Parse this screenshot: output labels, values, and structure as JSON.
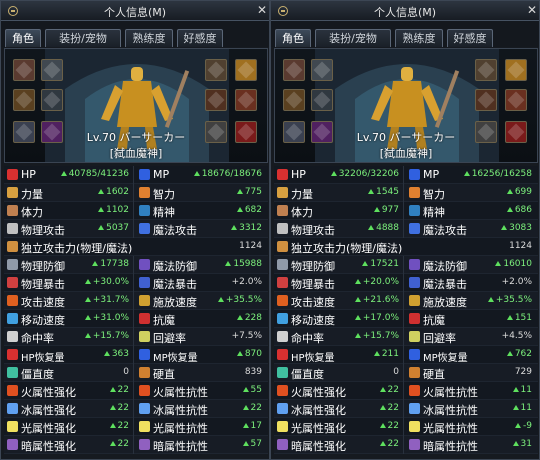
{
  "panels": [
    {
      "title": "个人信息(M)",
      "tabs": [
        "角色",
        "装扮/宠物",
        "熟练度",
        "好感度"
      ],
      "level": "Lv.70 バーサーカー",
      "char_title": "[弑血魔神]",
      "stats": [
        {
          "type": "pair",
          "l": {
            "name": "HP",
            "value": "40785/41236",
            "up": true,
            "icon": "heart-icon",
            "color": "#d83030"
          },
          "r": {
            "name": "MP",
            "value": "18676/18676",
            "up": true,
            "icon": "mp-heart-icon",
            "color": "#3060e0"
          }
        },
        {
          "type": "pair",
          "l": {
            "name": "力量",
            "value": "1602",
            "up": true,
            "icon": "strength-icon",
            "color": "#d8a040"
          },
          "r": {
            "name": "智力",
            "value": "775",
            "up": true,
            "icon": "intelligence-icon",
            "color": "#e08030"
          }
        },
        {
          "type": "pair",
          "l": {
            "name": "体力",
            "value": "1102",
            "up": true,
            "icon": "vitality-icon",
            "color": "#c08050"
          },
          "r": {
            "name": "精神",
            "value": "682",
            "up": true,
            "icon": "spirit-icon",
            "color": "#3080c0"
          }
        },
        {
          "type": "pair",
          "l": {
            "name": "物理攻击",
            "value": "5037",
            "up": true,
            "icon": "phys-attack-icon",
            "color": "#c0c0c0"
          },
          "r": {
            "name": "魔法攻击",
            "value": "3312",
            "up": true,
            "icon": "magic-attack-icon",
            "color": "#4070e0"
          }
        },
        {
          "type": "full",
          "l": {
            "name": "独立攻击力(物理/魔法)",
            "value": "1124",
            "up": false,
            "icon": "independent-attack-icon",
            "color": "#d09040"
          }
        },
        {
          "type": "pair",
          "l": {
            "name": "物理防御",
            "value": "17738",
            "up": true,
            "icon": "phys-defense-icon",
            "color": "#909aa8"
          },
          "r": {
            "name": "魔法防御",
            "value": "15988",
            "up": true,
            "icon": "magic-defense-icon",
            "color": "#7050c0"
          }
        },
        {
          "type": "pair",
          "l": {
            "name": "物理暴击",
            "value": "+30.0%",
            "up": true,
            "icon": "phys-crit-icon",
            "color": "#d04040"
          },
          "r": {
            "name": "魔法暴击",
            "value": "+2.0%",
            "up": false,
            "icon": "magic-crit-icon",
            "color": "#4060d0"
          }
        },
        {
          "type": "pair",
          "l": {
            "name": "攻击速度",
            "value": "+31.7%",
            "up": true,
            "icon": "attack-speed-icon",
            "color": "#e06020"
          },
          "r": {
            "name": "施放速度",
            "value": "+35.5%",
            "up": true,
            "icon": "cast-speed-icon",
            "color": "#d0a030"
          }
        },
        {
          "type": "pair",
          "l": {
            "name": "移动速度",
            "value": "+31.0%",
            "up": true,
            "icon": "move-speed-icon",
            "color": "#40a0e0"
          },
          "r": {
            "name": "抗魔",
            "value": "228",
            "up": true,
            "icon": "magic-resist-icon",
            "color": "#d03030"
          }
        },
        {
          "type": "pair",
          "l": {
            "name": "命中率",
            "value": "+15.7%",
            "up": true,
            "icon": "hit-rate-icon",
            "color": "#d0d0d0"
          },
          "r": {
            "name": "回避率",
            "value": "+7.5%",
            "up": false,
            "icon": "evasion-icon",
            "color": "#d0d060"
          }
        },
        {
          "type": "pair",
          "l": {
            "name": "HP恢复量",
            "value": "363",
            "up": true,
            "icon": "hp-regen-icon",
            "color": "#d83030",
            "small": true
          },
          "r": {
            "name": "MP恢复量",
            "value": "870",
            "up": true,
            "icon": "mp-regen-icon",
            "color": "#3060e0",
            "small": true
          }
        },
        {
          "type": "pair",
          "l": {
            "name": "僵直度",
            "value": "0",
            "up": false,
            "icon": "stiffness-icon",
            "color": "#40c0a0"
          },
          "r": {
            "name": "硬直",
            "value": "839",
            "up": false,
            "icon": "hit-recovery-icon",
            "color": "#d08030"
          }
        },
        {
          "type": "pair",
          "l": {
            "name": "火属性强化",
            "value": "22",
            "up": true,
            "icon": "fire-boost-icon",
            "color": "#e05020"
          },
          "r": {
            "name": "火属性抗性",
            "value": "55",
            "up": true,
            "icon": "fire-resist-icon",
            "color": "#e05020"
          }
        },
        {
          "type": "pair",
          "l": {
            "name": "冰属性强化",
            "value": "22",
            "up": true,
            "icon": "ice-boost-icon",
            "color": "#60a0f0"
          },
          "r": {
            "name": "冰属性抗性",
            "value": "22",
            "up": true,
            "icon": "ice-resist-icon",
            "color": "#60a0f0"
          }
        },
        {
          "type": "pair",
          "l": {
            "name": "光属性强化",
            "value": "22",
            "up": true,
            "icon": "light-boost-icon",
            "color": "#f0e060"
          },
          "r": {
            "name": "光属性抗性",
            "value": "17",
            "up": true,
            "icon": "light-resist-icon",
            "color": "#f0e060"
          }
        },
        {
          "type": "pair",
          "l": {
            "name": "暗属性强化",
            "value": "22",
            "up": true,
            "icon": "dark-boost-icon",
            "color": "#9060c0"
          },
          "r": {
            "name": "暗属性抗性",
            "value": "57",
            "up": true,
            "icon": "dark-resist-icon",
            "color": "#9060c0"
          }
        }
      ]
    },
    {
      "title": "个人信息(M)",
      "tabs": [
        "角色",
        "装扮/宠物",
        "熟练度",
        "好感度"
      ],
      "level": "Lv.70 バーサーカー",
      "char_title": "[弑血魔神]",
      "stats": [
        {
          "type": "pair",
          "l": {
            "name": "HP",
            "value": "32206/32206",
            "up": true,
            "icon": "heart-icon",
            "color": "#d83030"
          },
          "r": {
            "name": "MP",
            "value": "16256/16258",
            "up": true,
            "icon": "mp-heart-icon",
            "color": "#3060e0"
          }
        },
        {
          "type": "pair",
          "l": {
            "name": "力量",
            "value": "1545",
            "up": true,
            "icon": "strength-icon",
            "color": "#d8a040"
          },
          "r": {
            "name": "智力",
            "value": "699",
            "up": true,
            "icon": "intelligence-icon",
            "color": "#e08030"
          }
        },
        {
          "type": "pair",
          "l": {
            "name": "体力",
            "value": "977",
            "up": true,
            "icon": "vitality-icon",
            "color": "#c08050"
          },
          "r": {
            "name": "精神",
            "value": "686",
            "up": true,
            "icon": "spirit-icon",
            "color": "#3080c0"
          }
        },
        {
          "type": "pair",
          "l": {
            "name": "物理攻击",
            "value": "4888",
            "up": true,
            "icon": "phys-attack-icon",
            "color": "#c0c0c0"
          },
          "r": {
            "name": "魔法攻击",
            "value": "3083",
            "up": true,
            "icon": "magic-attack-icon",
            "color": "#4070e0"
          }
        },
        {
          "type": "full",
          "l": {
            "name": "独立攻击力(物理/魔法)",
            "value": "1124",
            "up": false,
            "icon": "independent-attack-icon",
            "color": "#d09040"
          }
        },
        {
          "type": "pair",
          "l": {
            "name": "物理防御",
            "value": "17521",
            "up": true,
            "icon": "phys-defense-icon",
            "color": "#909aa8"
          },
          "r": {
            "name": "魔法防御",
            "value": "16010",
            "up": true,
            "icon": "magic-defense-icon",
            "color": "#7050c0"
          }
        },
        {
          "type": "pair",
          "l": {
            "name": "物理暴击",
            "value": "+20.0%",
            "up": true,
            "icon": "phys-crit-icon",
            "color": "#d04040"
          },
          "r": {
            "name": "魔法暴击",
            "value": "+2.0%",
            "up": false,
            "icon": "magic-crit-icon",
            "color": "#4060d0"
          }
        },
        {
          "type": "pair",
          "l": {
            "name": "攻击速度",
            "value": "+21.6%",
            "up": true,
            "icon": "attack-speed-icon",
            "color": "#e06020"
          },
          "r": {
            "name": "施放速度",
            "value": "+35.5%",
            "up": true,
            "icon": "cast-speed-icon",
            "color": "#d0a030"
          }
        },
        {
          "type": "pair",
          "l": {
            "name": "移动速度",
            "value": "+17.0%",
            "up": true,
            "icon": "move-speed-icon",
            "color": "#40a0e0"
          },
          "r": {
            "name": "抗魔",
            "value": "151",
            "up": true,
            "icon": "magic-resist-icon",
            "color": "#d03030"
          }
        },
        {
          "type": "pair",
          "l": {
            "name": "命中率",
            "value": "+15.7%",
            "up": true,
            "icon": "hit-rate-icon",
            "color": "#d0d0d0"
          },
          "r": {
            "name": "回避率",
            "value": "+4.5%",
            "up": false,
            "icon": "evasion-icon",
            "color": "#d0d060"
          }
        },
        {
          "type": "pair",
          "l": {
            "name": "HP恢复量",
            "value": "211",
            "up": true,
            "icon": "hp-regen-icon",
            "color": "#d83030",
            "small": true
          },
          "r": {
            "name": "MP恢复量",
            "value": "762",
            "up": true,
            "icon": "mp-regen-icon",
            "color": "#3060e0",
            "small": true
          }
        },
        {
          "type": "pair",
          "l": {
            "name": "僵直度",
            "value": "0",
            "up": false,
            "icon": "stiffness-icon",
            "color": "#40c0a0"
          },
          "r": {
            "name": "硬直",
            "value": "729",
            "up": false,
            "icon": "hit-recovery-icon",
            "color": "#d08030"
          }
        },
        {
          "type": "pair",
          "l": {
            "name": "火属性强化",
            "value": "22",
            "up": true,
            "icon": "fire-boost-icon",
            "color": "#e05020"
          },
          "r": {
            "name": "火属性抗性",
            "value": "11",
            "up": true,
            "icon": "fire-resist-icon",
            "color": "#e05020"
          }
        },
        {
          "type": "pair",
          "l": {
            "name": "冰属性强化",
            "value": "22",
            "up": true,
            "icon": "ice-boost-icon",
            "color": "#60a0f0"
          },
          "r": {
            "name": "冰属性抗性",
            "value": "11",
            "up": true,
            "icon": "ice-resist-icon",
            "color": "#60a0f0"
          }
        },
        {
          "type": "pair",
          "l": {
            "name": "光属性强化",
            "value": "22",
            "up": true,
            "icon": "light-boost-icon",
            "color": "#f0e060"
          },
          "r": {
            "name": "光属性抗性",
            "value": "-9",
            "up": true,
            "icon": "light-resist-icon",
            "color": "#f0e060"
          }
        },
        {
          "type": "pair",
          "l": {
            "name": "暗属性强化",
            "value": "22",
            "up": true,
            "icon": "dark-boost-icon",
            "color": "#9060c0"
          },
          "r": {
            "name": "暗属性抗性",
            "value": "31",
            "up": true,
            "icon": "dark-resist-icon",
            "color": "#9060c0"
          }
        }
      ]
    }
  ]
}
